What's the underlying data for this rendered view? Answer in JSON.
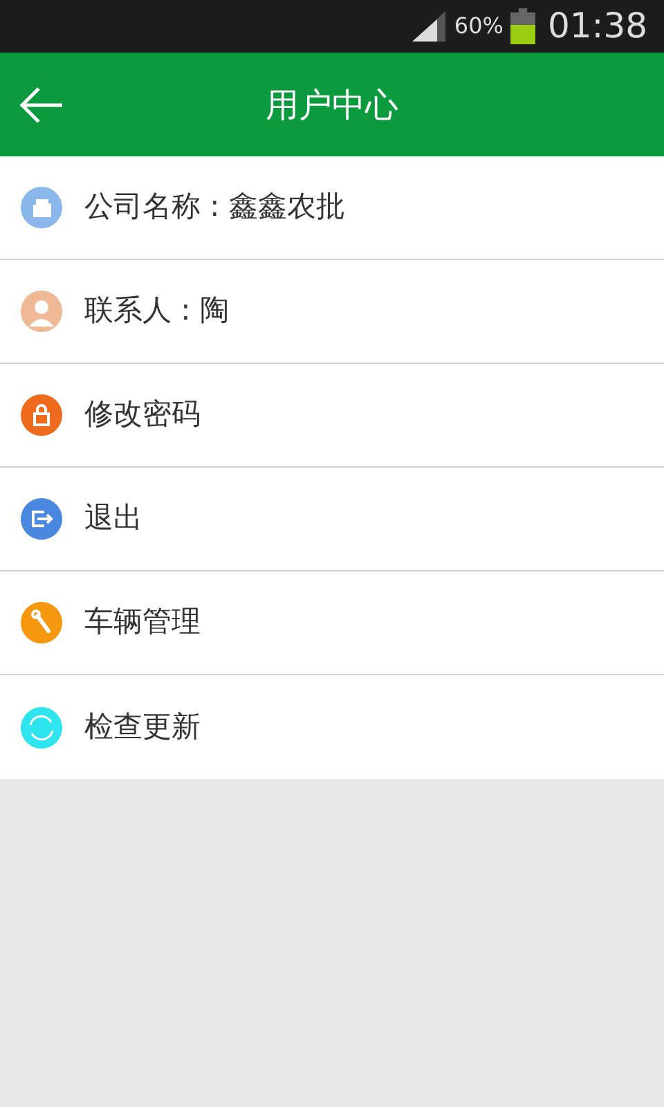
{
  "status_bar": {
    "battery": "60%",
    "time": "01:38"
  },
  "header": {
    "title": "用户中心"
  },
  "menu": [
    {
      "kind": "building",
      "color": "#8ab8ea",
      "label": "公司名称 : 鑫鑫农批"
    },
    {
      "kind": "person",
      "color": "#f0b995",
      "label": "联系人 : 陶"
    },
    {
      "kind": "lock",
      "color": "#ee6a1c",
      "label": "修改密码"
    },
    {
      "kind": "exit",
      "color": "#4a88e0",
      "label": "退出"
    },
    {
      "kind": "wrench",
      "color": "#f6980f",
      "label": "车辆管理"
    },
    {
      "kind": "refresh",
      "color": "#2ee4ee",
      "label": "检查更新"
    }
  ]
}
